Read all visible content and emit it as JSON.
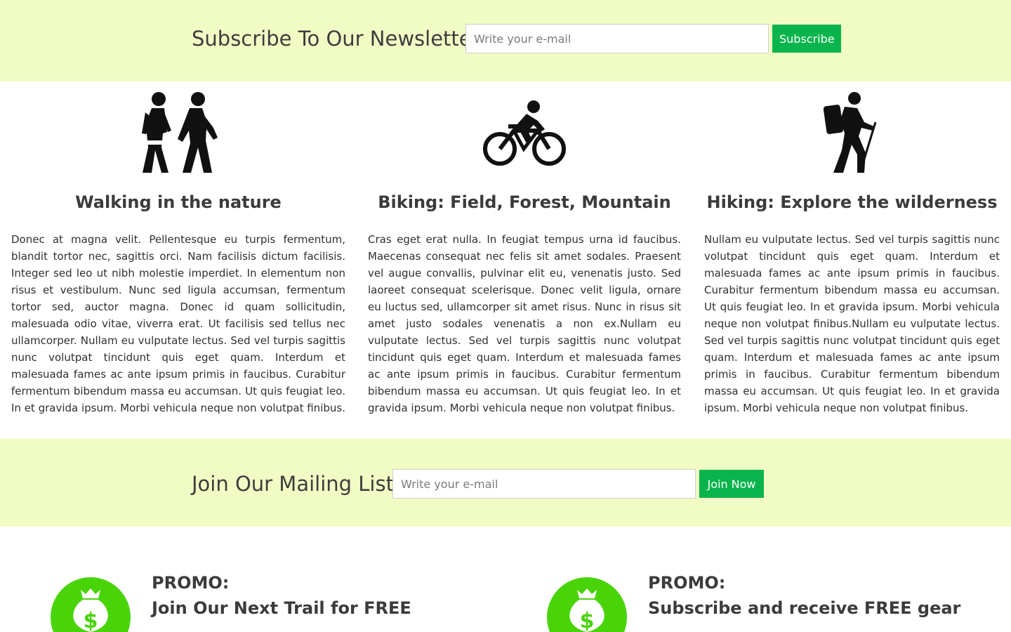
{
  "newsletter": {
    "title": "Subscribe To Our Newsletter",
    "email_placeholder": "Write your e-mail",
    "button_label": "Subscribe"
  },
  "activities": [
    {
      "icon": "walking-people-icon",
      "title": "Walking in the nature",
      "text": "Donec at magna velit. Pellentesque eu turpis fermentum, blandit tortor nec, sagittis orci. Nam facilisis dictum facilisis. Integer sed leo ut nibh molestie imperdiet. In elementum non risus et vestibulum. Nunc sed ligula accumsan, fermentum tortor sed, auctor magna. Donec id quam sollicitudin, malesuada odio vitae, viverra erat. Ut facilisis sed tellus nec ullamcorper. Nullam eu vulputate lectus. Sed vel turpis sagittis nunc volutpat tincidunt quis eget quam. Interdum et malesuada fames ac ante ipsum primis in faucibus. Curabitur fermentum bibendum massa eu accumsan. Ut quis feugiat leo. In et gravida ipsum. Morbi vehicula neque non volutpat finibus."
    },
    {
      "icon": "cyclist-icon",
      "title": "Biking: Field, Forest, Mountain",
      "text": "Cras eget erat nulla. In feugiat tempus urna id faucibus. Maecenas consequat nec felis sit amet sodales. Praesent vel augue convallis, pulvinar elit eu, venenatis justo. Sed laoreet consequat scelerisque. Donec velit ligula, ornare eu luctus sed, ullamcorper sit amet risus. Nunc in risus sit amet justo sodales venenatis a non ex.Nullam eu vulputate lectus. Sed vel turpis sagittis nunc volutpat tincidunt quis eget quam. Interdum et malesuada fames ac ante ipsum primis in faucibus. Curabitur fermentum bibendum massa eu accumsan. Ut quis feugiat leo. In et gravida ipsum. Morbi vehicula neque non volutpat finibus."
    },
    {
      "icon": "hiker-icon",
      "title": "Hiking: Explore the wilderness",
      "text": "Nullam eu vulputate lectus. Sed vel turpis sagittis nunc volutpat tincidunt quis eget quam. Interdum et malesuada fames ac ante ipsum primis in faucibus. Curabitur fermentum bibendum massa eu accumsan. Ut quis feugiat leo. In et gravida ipsum. Morbi vehicula neque non volutpat finibus.Nullam eu vulputate lectus. Sed vel turpis sagittis nunc volutpat tincidunt quis eget quam. Interdum et malesuada fames ac ante ipsum primis in faucibus. Curabitur fermentum bibendum massa eu accumsan. Ut quis feugiat leo. In et gravida ipsum. Morbi vehicula neque non volutpat finibus."
    }
  ],
  "mailing": {
    "title": "Join Our Mailing List",
    "email_placeholder": "Write your e-mail",
    "button_label": "Join Now"
  },
  "promos": [
    {
      "icon": "money-bag-icon",
      "label": "PROMO:",
      "title": "Join Our Next Trail for FREE"
    },
    {
      "icon": "money-bag-icon",
      "label": "PROMO:",
      "title": "Subscribe and receive FREE gear"
    }
  ],
  "colors": {
    "band_background": "#f1fcc4",
    "button_green": "#09b44c",
    "promo_icon_green": "#49d40a",
    "text": "#3a3a3a"
  }
}
